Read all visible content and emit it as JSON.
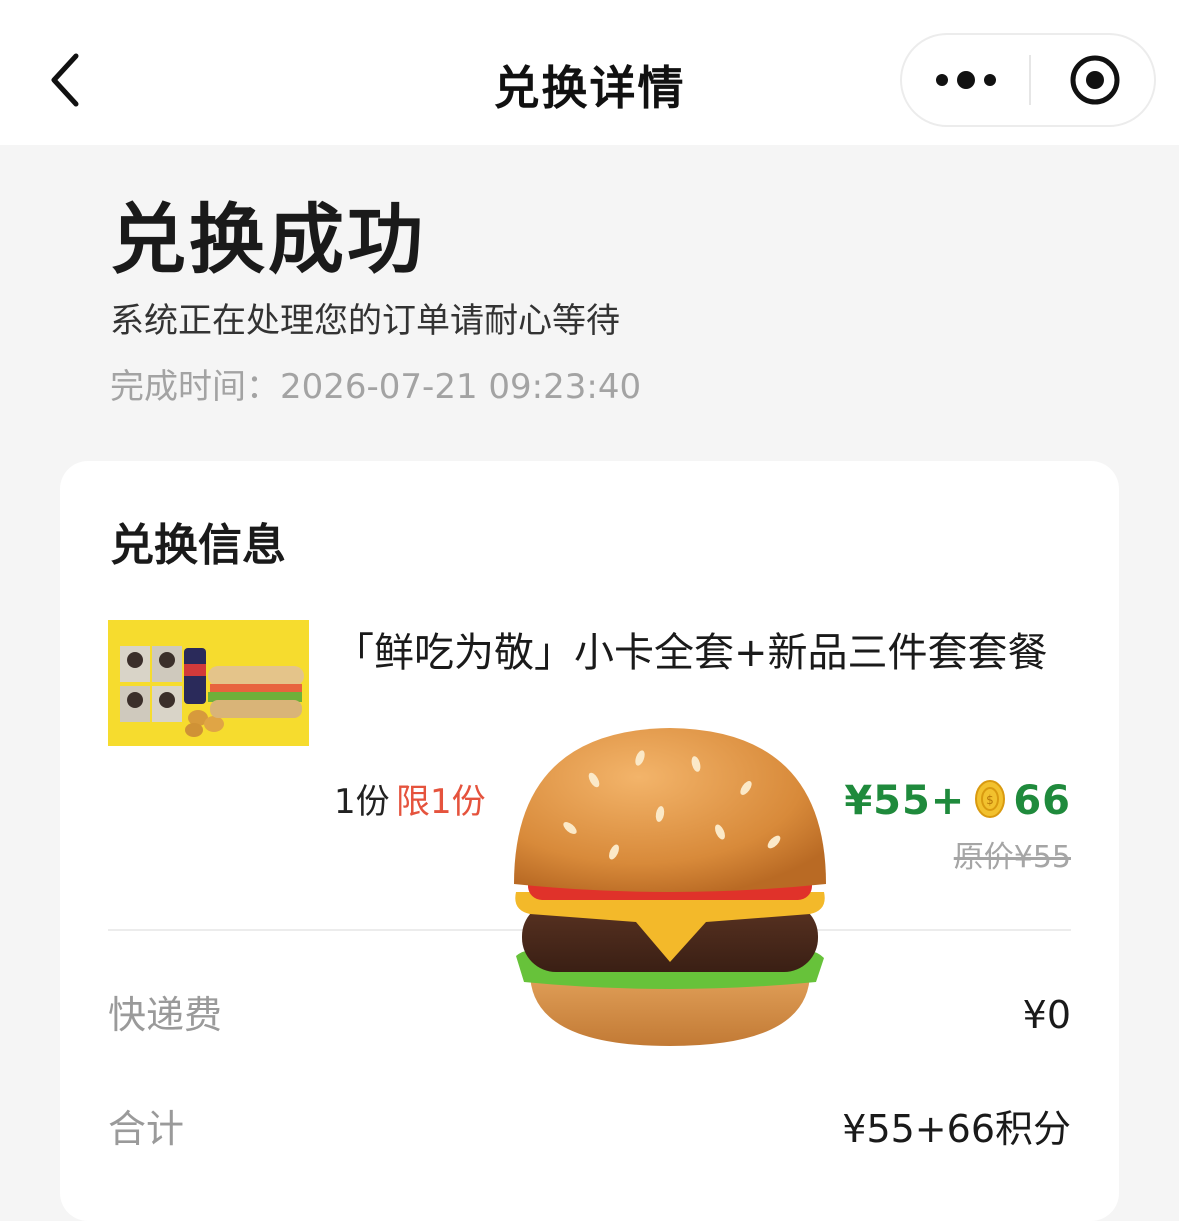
{
  "navbar": {
    "title": "兑换详情"
  },
  "status": {
    "title": "兑换成功",
    "subtitle": "系统正在处理您的订单请耐心等待",
    "time_label": "完成时间：",
    "time_value": "2026-07-21 09:23:40"
  },
  "card": {
    "title": "兑换信息",
    "product": {
      "name": "「鲜吃为敬」小卡全套+新品三件套套餐",
      "quantity": "1份",
      "limit": "限1份",
      "price_cash": "¥55+",
      "price_points": "66",
      "original_price": "原价¥55",
      "thumbnail_icon": "product-photo-sandwich-combo"
    },
    "shipping": {
      "label": "快递费",
      "value": "¥0"
    },
    "total": {
      "label": "合计",
      "value": "¥55+66积分"
    }
  },
  "icons": {
    "back": "chevron-left-icon",
    "more": "more-dots-icon",
    "close": "target-circle-icon",
    "coin": "coin-icon",
    "overlay": "hamburger-emoji"
  },
  "colors": {
    "price_green": "#1f8a3c",
    "limit_red": "#e5533d",
    "muted_gray": "#9a9a9a",
    "thumbnail_yellow": "#f6dc2e"
  }
}
